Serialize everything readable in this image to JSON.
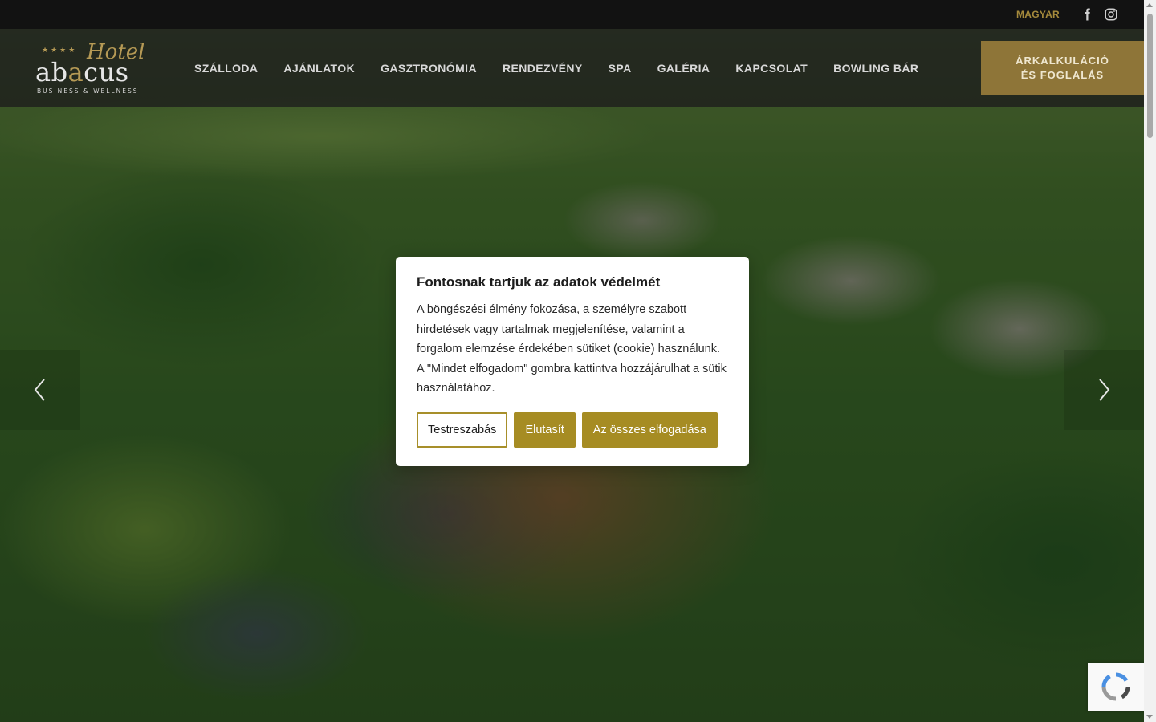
{
  "topbar": {
    "language": "MAGYAR",
    "social": [
      "facebook-icon",
      "instagram-icon"
    ]
  },
  "header": {
    "logo": {
      "stars": "★★★★",
      "script": "Hotel",
      "word_a": "ab",
      "word_gold": "a",
      "word_b": "cus",
      "subtitle": "BUSINESS & WELLNESS"
    },
    "nav": [
      {
        "label": "SZÁLLODA"
      },
      {
        "label": "AJÁNLATOK"
      },
      {
        "label": "GASZTRONÓMIA"
      },
      {
        "label": "RENDEZVÉNY"
      },
      {
        "label": "SPA"
      },
      {
        "label": "GALÉRIA"
      },
      {
        "label": "KAPCSOLAT"
      },
      {
        "label": "BOWLING BÁR"
      }
    ],
    "cta": {
      "line1": "ÁRKALKULÁCIÓ",
      "line2": "ÉS FOGLALÁS"
    }
  },
  "cookie": {
    "title": "Fontosnak tartjuk az adatok védelmét",
    "text": "A böngészési élmény fokozása, a személyre szabott hirdetések vagy tartalmak megjelenítése, valamint a forgalom elemzése érdekében sütiket (cookie) használunk. A \"Mindet elfogadom\" gombra kattintva hozzájárulhat a sütik használatához.",
    "buttons": {
      "customize": "Testreszabás",
      "reject": "Elutasít",
      "accept_all": "Az összes elfogadása"
    }
  },
  "colors": {
    "gold": "#a68c23",
    "gold_dark": "#8e7538",
    "topbar": "#121212"
  }
}
